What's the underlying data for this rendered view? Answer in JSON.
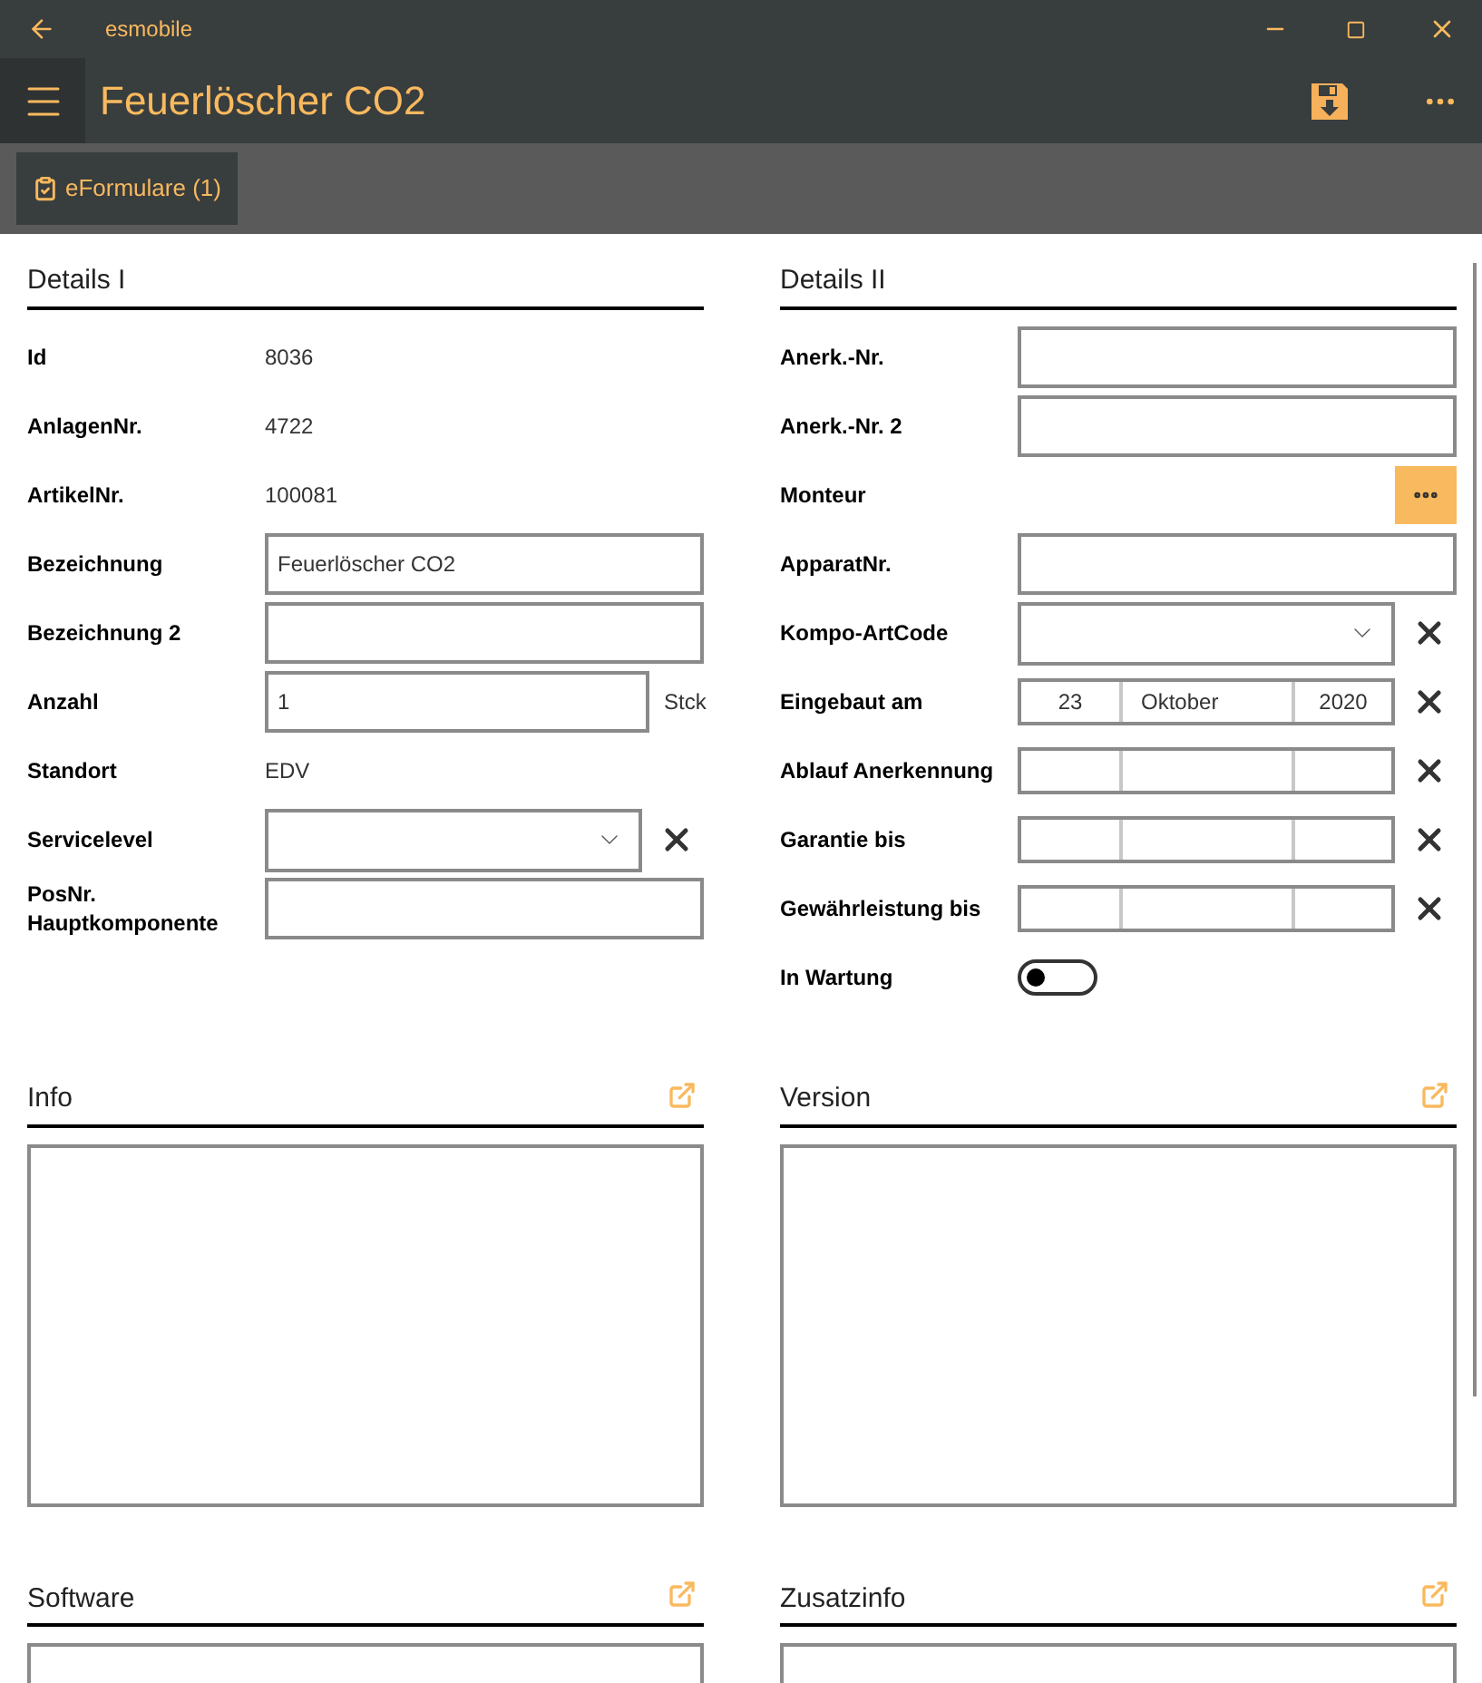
{
  "titlebar": {
    "app_name": "esmobile"
  },
  "header": {
    "title": "Feuerlöscher CO2"
  },
  "toolbar": {
    "button": "eFormulare (1)"
  },
  "details_1": {
    "heading": "Details I",
    "fields": [
      {
        "kind": "text",
        "label": "Id",
        "value": "8036"
      },
      {
        "kind": "text",
        "label": "AnlagenNr.",
        "value": "4722"
      },
      {
        "kind": "text",
        "label": "ArtikelNr.",
        "value": "100081"
      },
      {
        "kind": "input",
        "label": "Bezeichnung",
        "value": "Feuerlöscher CO2"
      },
      {
        "kind": "input",
        "label": "Bezeichnung 2"
      },
      {
        "kind": "unit",
        "label": "Anzahl",
        "value": "1",
        "unit": "Stck"
      },
      {
        "kind": "text",
        "label": "Standort",
        "value": "EDV"
      },
      {
        "kind": "select",
        "label": "Servicelevel"
      },
      {
        "kind": "input",
        "label": "PosNr. Hauptkomponente"
      }
    ]
  },
  "details_2": {
    "heading": "Details II",
    "fields": [
      {
        "kind": "input",
        "label": "Anerk.-Nr."
      },
      {
        "kind": "input",
        "label": "Anerk.-Nr. 2"
      },
      {
        "kind": "picker",
        "label": "Monteur"
      },
      {
        "kind": "input",
        "label": "ApparatNr."
      },
      {
        "kind": "select",
        "label": "Kompo-ArtCode"
      },
      {
        "kind": "date",
        "label": "Eingebaut am",
        "day": "23",
        "month": "Oktober",
        "year": "2020"
      },
      {
        "kind": "date",
        "label": "Ablauf Anerkennung"
      },
      {
        "kind": "date",
        "label": "Garantie bis"
      },
      {
        "kind": "date",
        "label": "Gewährleistung bis"
      },
      {
        "kind": "toggle",
        "label": "In Wartung",
        "on": false
      }
    ]
  },
  "notes": [
    {
      "heading": "Info"
    },
    {
      "heading": "Version"
    },
    {
      "heading": "Software"
    },
    {
      "heading": "Zusatzinfo"
    }
  ]
}
